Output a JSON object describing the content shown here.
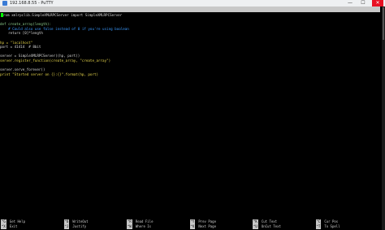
{
  "window": {
    "title": "192.168.8.55 - PuTTY",
    "controls": {
      "minimize": "—",
      "maximize": "☐",
      "close": "✕"
    }
  },
  "nano": {
    "version": "GNU nano 2.2.6",
    "file_label": "File: /home/scripts/hp_xmlrpc_server.py"
  },
  "code_lines": [
    {
      "text": "",
      "class": "",
      "cursor": true,
      "rest": "rom xmlrpclib.SimpleXMLRPCServer import SimpleXMLRPCServer"
    },
    {
      "text": "",
      "class": ""
    },
    {
      "text": "def create_array(length):",
      "class": "kw"
    },
    {
      "text": "    # Could also use false instead of 0 if you're using boolean",
      "class": "cm"
    },
    {
      "text": "    return [0]*length",
      "class": ""
    },
    {
      "text": "",
      "class": ""
    },
    {
      "text": "hp = \"localhost\"",
      "class": "st"
    },
    {
      "text": "port = 41414  # 8bit",
      "class": "num"
    },
    {
      "text": "",
      "class": ""
    },
    {
      "text": "server = SimpleXMLRPCServer((hp, port))",
      "class": ""
    },
    {
      "text": "server.register_function(create_array, \"create_array\")",
      "class": "st"
    },
    {
      "text": "",
      "class": ""
    },
    {
      "text": "server.serve_forever()",
      "class": ""
    },
    {
      "text": "print \"Started server on {}:{}\".format(hp, port)",
      "class": "st"
    }
  ],
  "help_row1": [
    {
      "key": "^G",
      "label": "Get Help"
    },
    {
      "key": "^O",
      "label": "WriteOut"
    },
    {
      "key": "^R",
      "label": "Read File"
    },
    {
      "key": "^Y",
      "label": "Prev Page"
    },
    {
      "key": "^K",
      "label": "Cut Text"
    },
    {
      "key": "^C",
      "label": "Cur Pos"
    }
  ],
  "help_row2": [
    {
      "key": "^X",
      "label": "Exit"
    },
    {
      "key": "^J",
      "label": "Justify"
    },
    {
      "key": "^W",
      "label": "Where Is"
    },
    {
      "key": "^V",
      "label": "Next Page"
    },
    {
      "key": "^U",
      "label": "UnCut Text"
    },
    {
      "key": "^T",
      "label": "To Spell"
    }
  ]
}
